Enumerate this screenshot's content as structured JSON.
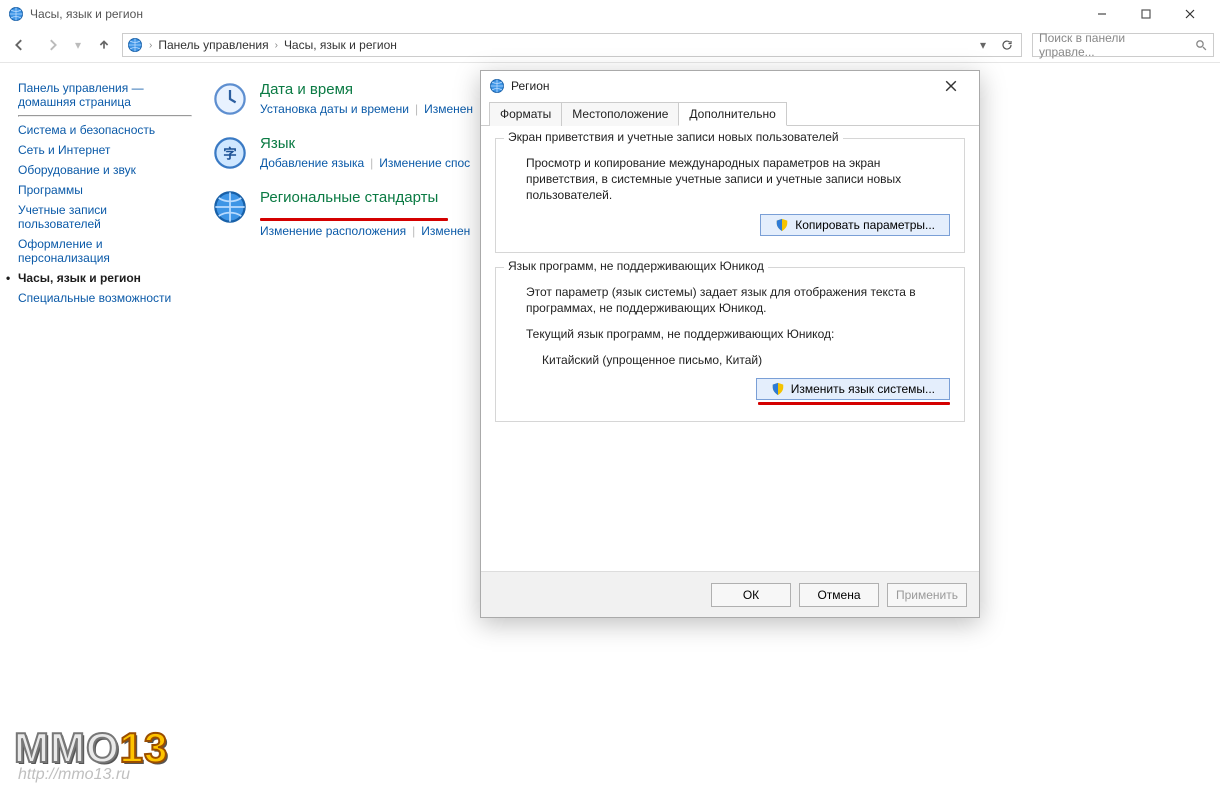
{
  "window": {
    "title": "Часы, язык и регион",
    "breadcrumbs": [
      "Панель управления",
      "Часы, язык и регион"
    ],
    "search_placeholder": "Поиск в панели управле..."
  },
  "sidebar": {
    "home": "Панель управления — домашняя страница",
    "items": [
      {
        "label": "Система и безопасность"
      },
      {
        "label": "Сеть и Интернет"
      },
      {
        "label": "Оборудование и звук"
      },
      {
        "label": "Программы"
      },
      {
        "label": "Учетные записи пользователей"
      },
      {
        "label": "Оформление и персонализация"
      },
      {
        "label": "Часы, язык и регион",
        "active": true
      },
      {
        "label": "Специальные возможности"
      }
    ]
  },
  "content": {
    "date_time": {
      "title": "Дата и время",
      "links": [
        "Установка даты и времени",
        "Изменен"
      ]
    },
    "language": {
      "title": "Язык",
      "links": [
        "Добавление языка",
        "Изменение спос"
      ]
    },
    "region": {
      "title": "Региональные стандарты",
      "links": [
        "Изменение расположения",
        "Изменен"
      ]
    }
  },
  "dialog": {
    "title": "Регион",
    "tabs": [
      "Форматы",
      "Местоположение",
      "Дополнительно"
    ],
    "active_tab": "Дополнительно",
    "group1": {
      "legend": "Экран приветствия и учетные записи новых пользователей",
      "text": "Просмотр и копирование международных параметров на экран приветствия, в системные учетные записи и учетные записи новых пользователей.",
      "button": "Копировать параметры..."
    },
    "group2": {
      "legend": "Язык программ, не поддерживающих Юникод",
      "text": "Этот параметр (язык системы) задает язык для отображения текста в программах, не поддерживающих Юникод.",
      "current_label": "Текущий язык программ, не поддерживающих Юникод:",
      "current_value": "Китайский (упрощенное письмо, Китай)",
      "button": "Изменить язык системы..."
    },
    "footer": {
      "ok": "ОК",
      "cancel": "Отмена",
      "apply": "Применить"
    }
  },
  "watermark": {
    "brand_a": "MMO",
    "brand_b": "13",
    "url": "http://mmo13.ru"
  }
}
